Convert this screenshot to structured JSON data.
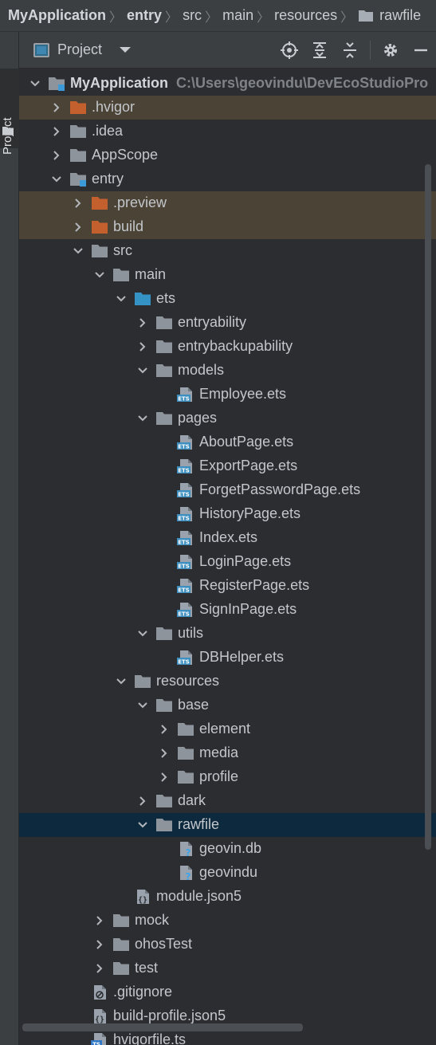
{
  "breadcrumb": {
    "items": [
      "MyApplication",
      "entry",
      "src",
      "main",
      "resources",
      "rawfile"
    ]
  },
  "side_panel": {
    "tab_label": "Project"
  },
  "toolbar": {
    "title": "Project",
    "icons": [
      "locate-icon",
      "expand-all-icon",
      "collapse-all-icon",
      "gear-icon",
      "minimize-icon"
    ]
  },
  "colors": {
    "folder_gray": "#8e949b",
    "folder_orange": "#c4602d",
    "folder_blue": "#3592c4",
    "excluded_bg": "#4a4336",
    "selected_bg": "#0d293e",
    "ets_blue": "#3d8fbf"
  },
  "tree": {
    "project_path": "C:\\Users\\geovindu\\DevEcoStudioPro",
    "rows": [
      {
        "label": "MyApplication",
        "depth": 0,
        "chevron": "down",
        "icon": "module-folder",
        "bold": true
      },
      {
        "label": ".hvigor",
        "depth": 1,
        "chevron": "right",
        "icon": "folder-orange",
        "excluded": true
      },
      {
        "label": ".idea",
        "depth": 1,
        "chevron": "right",
        "icon": "folder"
      },
      {
        "label": "AppScope",
        "depth": 1,
        "chevron": "right",
        "icon": "folder"
      },
      {
        "label": "entry",
        "depth": 1,
        "chevron": "down",
        "icon": "module-folder"
      },
      {
        "label": ".preview",
        "depth": 2,
        "chevron": "right",
        "icon": "folder-orange",
        "excluded": true
      },
      {
        "label": "build",
        "depth": 2,
        "chevron": "right",
        "icon": "folder-orange",
        "excluded": true
      },
      {
        "label": "src",
        "depth": 2,
        "chevron": "down",
        "icon": "folder"
      },
      {
        "label": "main",
        "depth": 3,
        "chevron": "down",
        "icon": "folder"
      },
      {
        "label": "ets",
        "depth": 4,
        "chevron": "down",
        "icon": "folder-blue"
      },
      {
        "label": "entryability",
        "depth": 5,
        "chevron": "right",
        "icon": "folder"
      },
      {
        "label": "entrybackupability",
        "depth": 5,
        "chevron": "right",
        "icon": "folder"
      },
      {
        "label": "models",
        "depth": 5,
        "chevron": "down",
        "icon": "folder"
      },
      {
        "label": "Employee.ets",
        "depth": 6,
        "chevron": "none",
        "icon": "ets"
      },
      {
        "label": "pages",
        "depth": 5,
        "chevron": "down",
        "icon": "folder"
      },
      {
        "label": "AboutPage.ets",
        "depth": 6,
        "chevron": "none",
        "icon": "ets"
      },
      {
        "label": "ExportPage.ets",
        "depth": 6,
        "chevron": "none",
        "icon": "ets"
      },
      {
        "label": "ForgetPasswordPage.ets",
        "depth": 6,
        "chevron": "none",
        "icon": "ets"
      },
      {
        "label": "HistoryPage.ets",
        "depth": 6,
        "chevron": "none",
        "icon": "ets"
      },
      {
        "label": "Index.ets",
        "depth": 6,
        "chevron": "none",
        "icon": "ets"
      },
      {
        "label": "LoginPage.ets",
        "depth": 6,
        "chevron": "none",
        "icon": "ets"
      },
      {
        "label": "RegisterPage.ets",
        "depth": 6,
        "chevron": "none",
        "icon": "ets"
      },
      {
        "label": "SignInPage.ets",
        "depth": 6,
        "chevron": "none",
        "icon": "ets"
      },
      {
        "label": "utils",
        "depth": 5,
        "chevron": "down",
        "icon": "folder"
      },
      {
        "label": "DBHelper.ets",
        "depth": 6,
        "chevron": "none",
        "icon": "ets"
      },
      {
        "label": "resources",
        "depth": 4,
        "chevron": "down",
        "icon": "folder"
      },
      {
        "label": "base",
        "depth": 5,
        "chevron": "down",
        "icon": "folder"
      },
      {
        "label": "element",
        "depth": 6,
        "chevron": "right",
        "icon": "folder"
      },
      {
        "label": "media",
        "depth": 6,
        "chevron": "right",
        "icon": "folder"
      },
      {
        "label": "profile",
        "depth": 6,
        "chevron": "right",
        "icon": "folder"
      },
      {
        "label": "dark",
        "depth": 5,
        "chevron": "right",
        "icon": "folder"
      },
      {
        "label": "rawfile",
        "depth": 5,
        "chevron": "down",
        "icon": "folder",
        "selected": true
      },
      {
        "label": "geovin.db",
        "depth": 6,
        "chevron": "none",
        "icon": "unknown-file"
      },
      {
        "label": "geovindu",
        "depth": 6,
        "chevron": "none",
        "icon": "unknown-file"
      },
      {
        "label": "module.json5",
        "depth": 4,
        "chevron": "none",
        "icon": "json-file"
      },
      {
        "label": "mock",
        "depth": 3,
        "chevron": "right",
        "icon": "folder"
      },
      {
        "label": "ohosTest",
        "depth": 3,
        "chevron": "right",
        "icon": "folder"
      },
      {
        "label": "test",
        "depth": 3,
        "chevron": "right",
        "icon": "folder"
      },
      {
        "label": ".gitignore",
        "depth": 2,
        "chevron": "none",
        "icon": "ignore-file"
      },
      {
        "label": "build-profile.json5",
        "depth": 2,
        "chevron": "none",
        "icon": "json-file"
      },
      {
        "label": "hvigorfile.ts",
        "depth": 2,
        "chevron": "none",
        "icon": "ts-file"
      }
    ]
  }
}
